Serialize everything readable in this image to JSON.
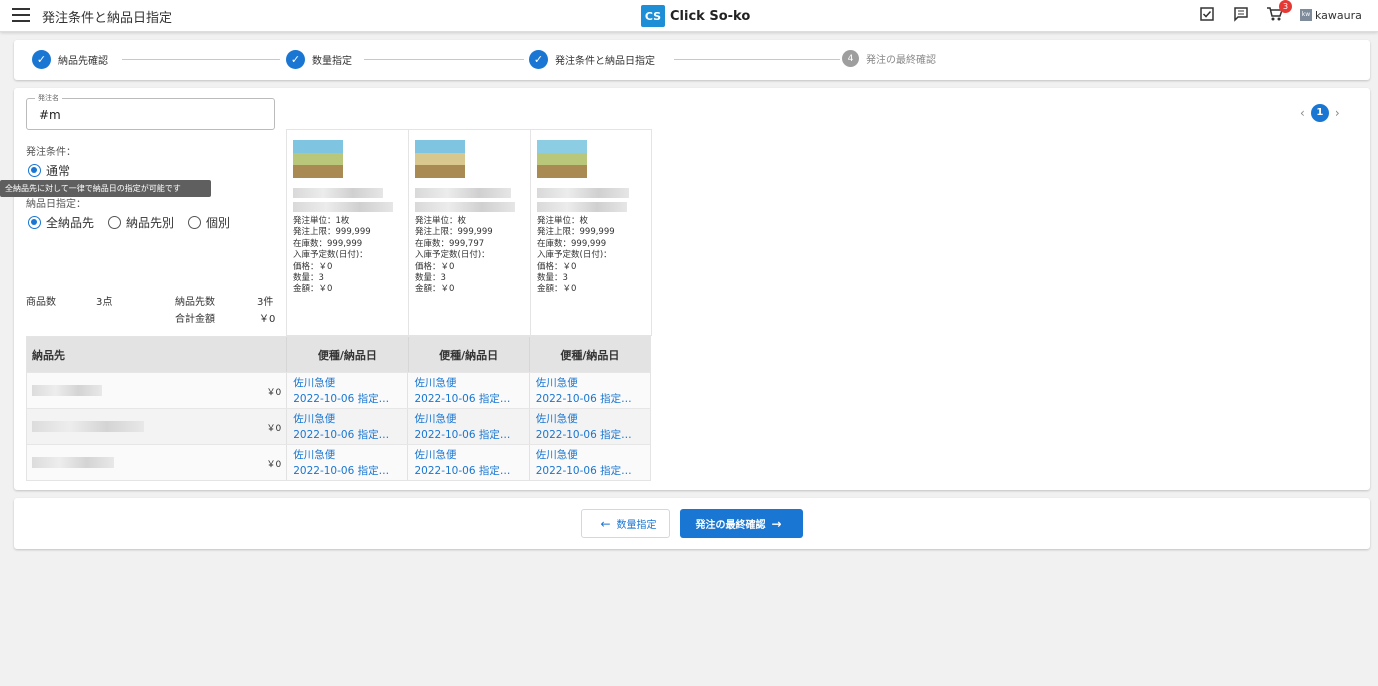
{
  "header": {
    "page_title": "発注条件と納品日指定",
    "brand_logo": "CS",
    "brand_name": "Click So-ko",
    "cart_count": "3",
    "user_initial": "kw",
    "user_name": "kawaura",
    "icons": [
      "menu-icon",
      "checkbox-icon",
      "message-icon",
      "cart-icon"
    ]
  },
  "stepper": {
    "steps": [
      {
        "label": "納品先確認",
        "state": "done"
      },
      {
        "label": "数量指定",
        "state": "done"
      },
      {
        "label": "発注条件と納品日指定",
        "state": "done"
      },
      {
        "label": "発注の最終確認",
        "state": "pending",
        "number": "4"
      }
    ]
  },
  "form": {
    "order_name_label": "発注名",
    "order_name_value": "#m",
    "order_condition_label": "発注条件：",
    "order_condition_option": "通常",
    "tooltip": "全納品先に対して一律で納品日の指定が可能です",
    "delivery_date_label": "納品日指定：",
    "delivery_options": [
      "全納品先",
      "納品先別",
      "個別"
    ],
    "delivery_selected": "全納品先"
  },
  "summary": {
    "product_count_label": "商品数",
    "product_count_value": "3点",
    "destination_count_label": "納品先数",
    "destination_count_value": "3件",
    "total_label": "合計金額",
    "total_value": "￥0"
  },
  "products": [
    {
      "lines": [
        "発注単位：1枚",
        "発注上限：999,999",
        "在庫数：999,999",
        "入庫予定数(日付)：",
        "価格：￥0",
        "数量：3",
        "金額：￥0"
      ]
    },
    {
      "lines": [
        "発注単位：枚",
        "発注上限：999,999",
        "在庫数：999,797",
        "入庫予定数(日付)：",
        "価格：￥0",
        "数量：3",
        "金額：￥0"
      ]
    },
    {
      "lines": [
        "発注単位：枚",
        "発注上限：999,999",
        "在庫数：999,999",
        "入庫予定数(日付)：",
        "価格：￥0",
        "数量：3",
        "金額：￥0"
      ]
    }
  ],
  "table": {
    "dest_header": "納品先",
    "col_header": "便種/納品日",
    "rows": [
      {
        "amount": "￥0",
        "cells": [
          [
            "佐川急便",
            "2022-10-06 指定…"
          ],
          [
            "佐川急便",
            "2022-10-06 指定…"
          ],
          [
            "佐川急便",
            "2022-10-06 指定…"
          ]
        ]
      },
      {
        "amount": "￥0",
        "cells": [
          [
            "佐川急便",
            "2022-10-06 指定…"
          ],
          [
            "佐川急便",
            "2022-10-06 指定…"
          ],
          [
            "佐川急便",
            "2022-10-06 指定…"
          ]
        ]
      },
      {
        "amount": "￥0",
        "cells": [
          [
            "佐川急便",
            "2022-10-06 指定…"
          ],
          [
            "佐川急便",
            "2022-10-06 指定…"
          ],
          [
            "佐川急便",
            "2022-10-06 指定…"
          ]
        ]
      }
    ]
  },
  "pager": {
    "prev": "‹",
    "current": "1",
    "next": "›"
  },
  "nav": {
    "back_label": "数量指定",
    "next_label": "発注の最終確認"
  },
  "colors": {
    "accent": "#1976d2",
    "badge": "#e53935",
    "tooltip_bg": "#5f5f5f"
  }
}
